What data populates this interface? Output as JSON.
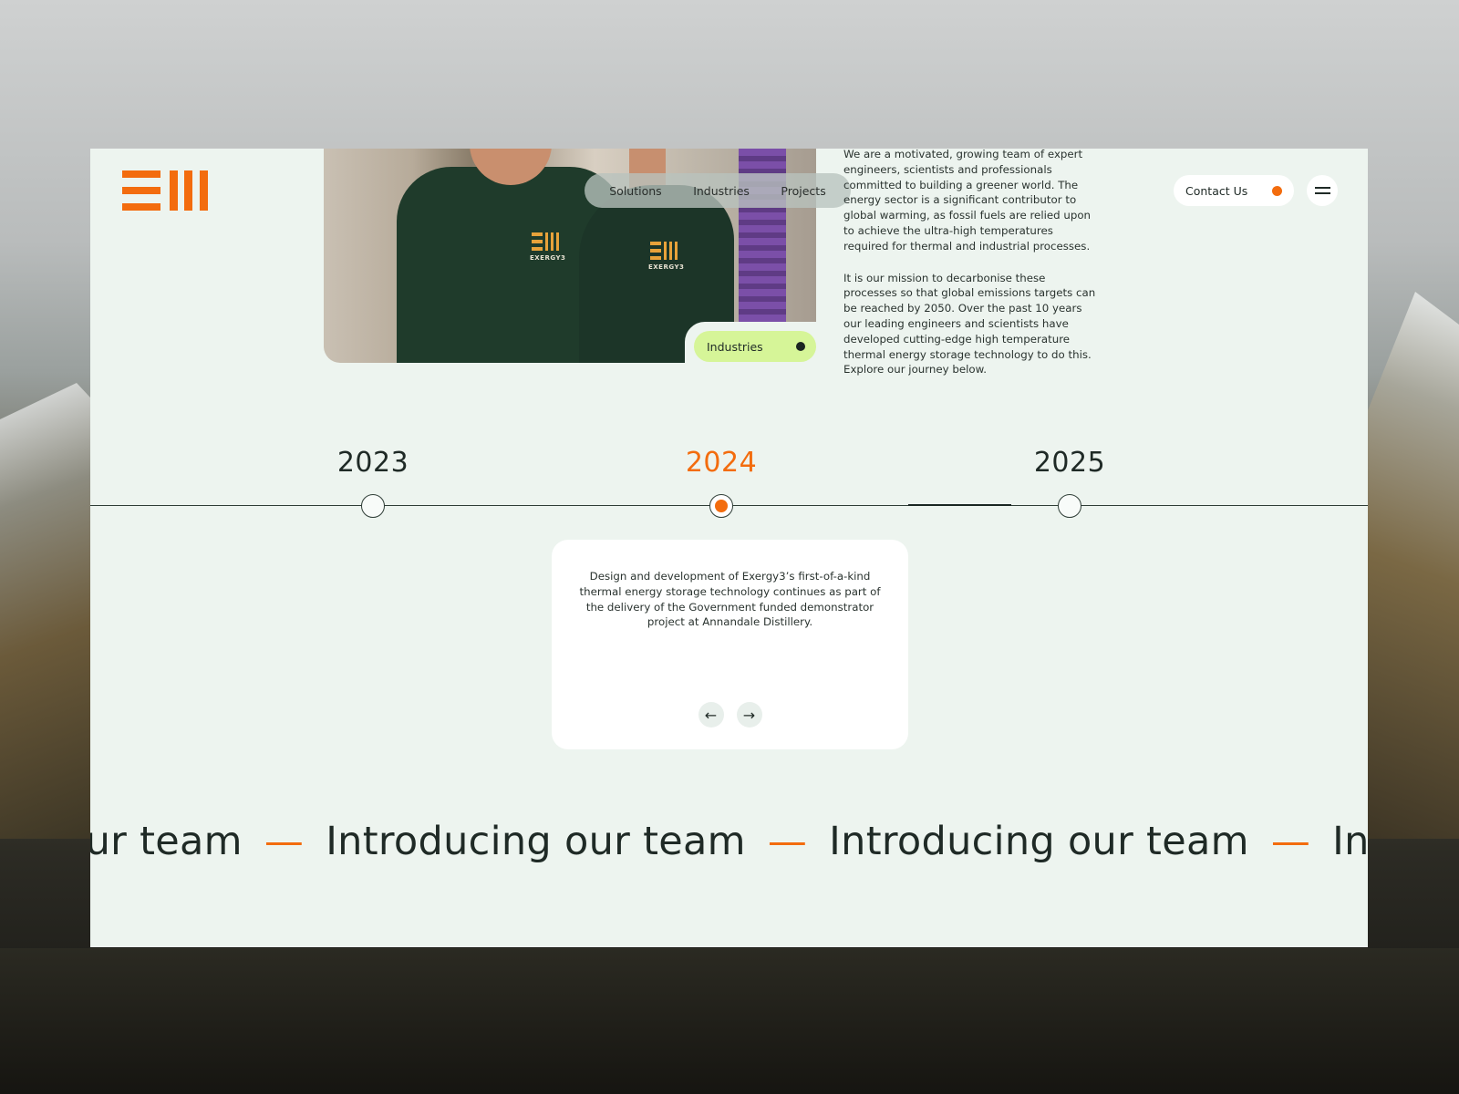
{
  "logo": {
    "name": "exergy3-logo"
  },
  "nav": {
    "items": [
      "Solutions",
      "Industries",
      "Projects"
    ]
  },
  "hero": {
    "tag_label": "Industries",
    "shirt_text": "EXERGY3"
  },
  "intro": {
    "paragraphs": [
      "We are a motivated, growing team of expert engineers, scientists and professionals committed to building a greener world. The energy sector is a significant contributor to global warming, as fossil fuels are relied upon to achieve the ultra-high temperatures required for thermal and industrial processes.",
      "It is our mission to decarbonise these processes so that global emissions targets can be reached by 2050. Over the past 10 years our leading engineers and scientists have developed cutting-edge high temperature thermal energy storage technology to do this. Explore our journey below."
    ]
  },
  "header": {
    "contact_label": "Contact Us"
  },
  "timeline": {
    "years": [
      "2023",
      "2024",
      "2025"
    ],
    "active": "2024",
    "card_text": "Design and development of Exergy3’s first-of-a-kind thermal energy storage technology continues as part of the delivery of the Government funded demonstrator project at Annandale Distillery."
  },
  "marquee": {
    "segments": [
      "our team",
      "Introducing our team",
      "Introducing our team",
      "Introducing"
    ],
    "separator": "—"
  },
  "icons": {
    "menu": "hamburger-icon",
    "prev": "arrow-left-icon",
    "next": "arrow-right-icon",
    "tag_dot": "dot-icon",
    "contact_dot": "dot-icon"
  },
  "colors": {
    "accent": "#f36c0e",
    "page_bg": "#edf4ef",
    "tag_bg": "#d6f598",
    "text": "#1f2a26"
  }
}
